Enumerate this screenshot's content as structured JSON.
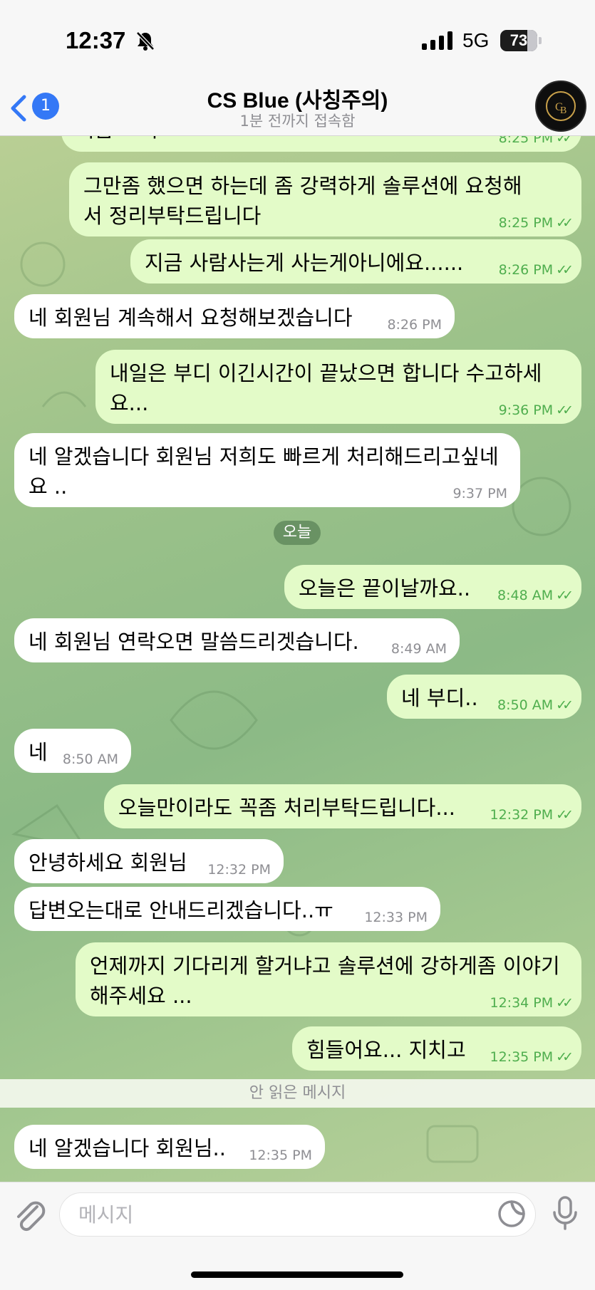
{
  "status_bar": {
    "time": "12:37",
    "network": "5G",
    "battery": "73",
    "battery_level": 0.73
  },
  "header": {
    "back_badge": "1",
    "title": "CS Blue (사칭주의)",
    "subtitle": "1분 전까지 접속함"
  },
  "messages": [
    {
      "dir": "out",
      "text": "지금도 지오",
      "time": "8:25 PM",
      "read": true
    },
    {
      "dir": "out",
      "text": "그만좀 했으면 하는데 좀 강력하게 솔루션에 요청해서 정리부탁드립니다",
      "time": "8:25 PM",
      "read": true
    },
    {
      "dir": "out",
      "text": "지금 사람사는게 사는게아니에요......",
      "time": "8:26 PM",
      "read": true
    },
    {
      "dir": "in",
      "text": "네 회원님 계속해서 요청해보겠습니다",
      "time": "8:26 PM"
    },
    {
      "dir": "out",
      "text": "내일은 부디 이긴시간이 끝났으면 합니다 수고하세요...",
      "time": "9:36 PM",
      "read": true
    },
    {
      "dir": "in",
      "text": "네 알겠습니다 회원님 저희도 빠르게 처리해드리고싶네요 ..",
      "time": "9:37 PM"
    },
    {
      "dir": "out",
      "text": "오늘은 끝이날까요..",
      "time": "8:48 AM",
      "read": true
    },
    {
      "dir": "in",
      "text": "네 회원님 연락오면 말씀드리겟습니다.",
      "time": "8:49 AM"
    },
    {
      "dir": "out",
      "text": "네 부디..",
      "time": "8:50 AM",
      "read": true
    },
    {
      "dir": "in",
      "text": "네",
      "time": "8:50 AM"
    },
    {
      "dir": "out",
      "text": "오늘만이라도 꼭좀 처리부탁드립니다...",
      "time": "12:32 PM",
      "read": true
    },
    {
      "dir": "in",
      "text": "안녕하세요 회원님",
      "time": "12:32 PM"
    },
    {
      "dir": "in",
      "text": "답변오는대로 안내드리겠습니다..ㅠ",
      "time": "12:33 PM"
    },
    {
      "dir": "out",
      "text": "언제까지 기다리게 할거냐고 솔루션에 강하게좀 이야기해주세요 ...",
      "time": "12:34 PM",
      "read": true
    },
    {
      "dir": "out",
      "text": "힘들어요... 지치고",
      "time": "12:35 PM",
      "read": true
    },
    {
      "dir": "in",
      "text": "네 알겠습니다 회원님..",
      "time": "12:35 PM"
    }
  ],
  "date_separator": "오늘",
  "unread_separator": "안 읽은 메시지",
  "input": {
    "placeholder": "메시지"
  },
  "colors": {
    "accent": "#3478f6",
    "outgoing_bubble": "#e3fbc8",
    "incoming_bubble": "#ffffff",
    "read_check": "#4fae4e"
  }
}
